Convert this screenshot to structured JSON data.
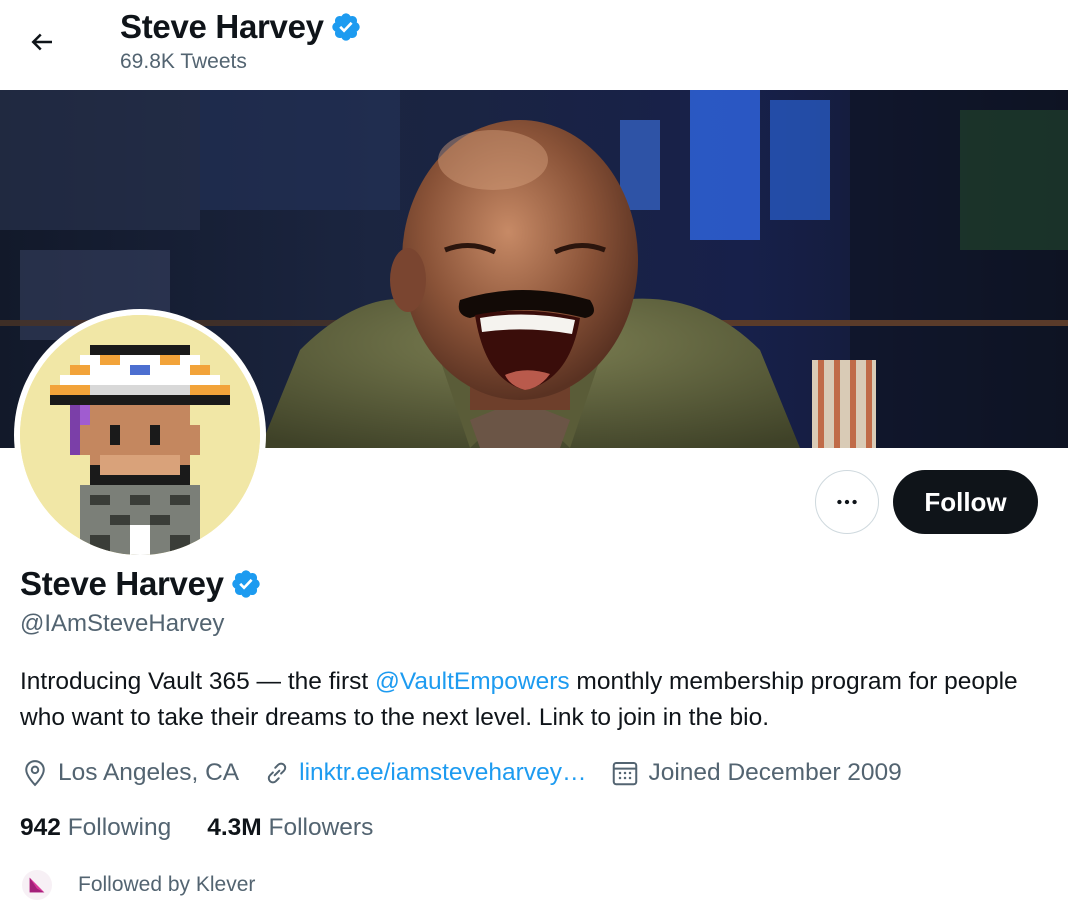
{
  "header": {
    "name": "Steve Harvey",
    "tweet_count": "69.8K Tweets"
  },
  "profile": {
    "name": "Steve Harvey",
    "handle": "@IAmSteveHarvey",
    "bio_before": "Introducing Vault 365 — the first ",
    "bio_mention": "@VaultEmpowers",
    "bio_after": " monthly membership program for people who want to take their dreams to the next level. Link to join in the bio.",
    "location": "Los Angeles, CA",
    "link": "linktr.ee/iamsteveharvey…",
    "joined": "Joined December 2009"
  },
  "actions": {
    "follow_label": "Follow",
    "more_icon": "more-dots-icon"
  },
  "stats": {
    "following_count": "942",
    "following_label": "Following",
    "followers_count": "4.3M",
    "followers_label": "Followers"
  },
  "followed_by": "Followed by Klever",
  "colors": {
    "accent": "#1d9bf0",
    "text": "#0f1419",
    "secondary": "#536471",
    "follow_button": "#0f1419"
  }
}
